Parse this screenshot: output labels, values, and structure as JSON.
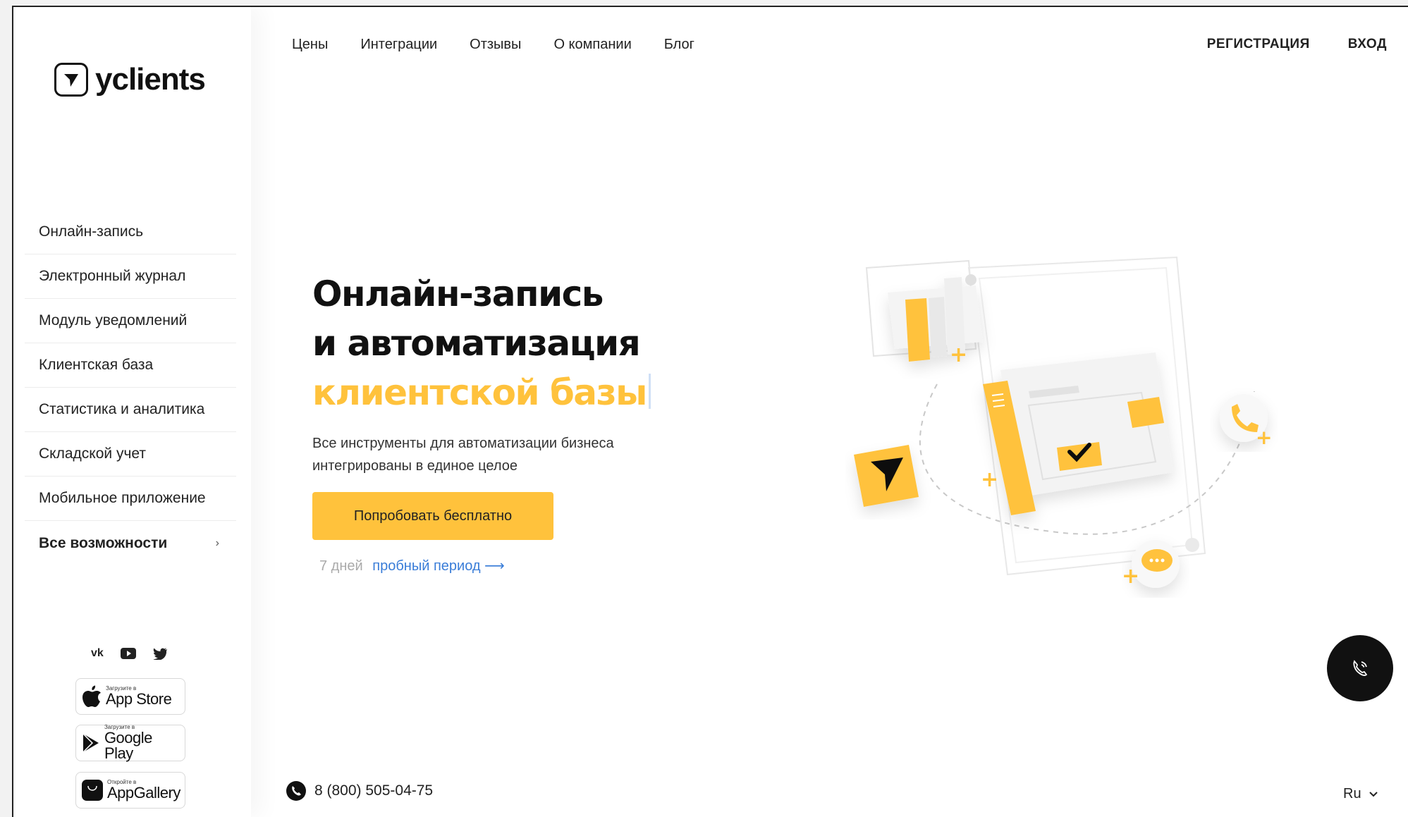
{
  "logo": {
    "text": "yclients"
  },
  "nav": {
    "links": [
      "Цены",
      "Интеграции",
      "Отзывы",
      "О компании",
      "Блог"
    ],
    "register": "РЕГИСТРАЦИЯ",
    "login": "ВХОД"
  },
  "sidebar": {
    "items": [
      "Онлайн-запись",
      "Электронный журнал",
      "Модуль уведомлений",
      "Клиентская база",
      "Статистика и аналитика",
      "Складской учет",
      "Мобильное приложение"
    ],
    "all_features": "Все возможности",
    "social_icons": [
      "vk-icon",
      "youtube-icon",
      "twitter-icon"
    ],
    "stores": [
      {
        "small": "Загрузите в",
        "big": "App Store",
        "icon": "apple-icon"
      },
      {
        "small": "Загрузите в",
        "big": "Google Play",
        "icon": "google-play-icon"
      },
      {
        "small": "Откройте в",
        "big": "AppGallery",
        "icon": "huawei-icon"
      }
    ]
  },
  "hero": {
    "title_line1": "Онлайн-запись",
    "title_line2": "и автоматизация",
    "title_accent": "клиентской базы",
    "subtitle_line1": "Все инструменты для автоматизации бизнеса",
    "subtitle_line2": "интегрированы в единое целое",
    "cta": "Попробовать бесплатно",
    "trial_days": "7 дней",
    "trial_link": "пробный период ⟶"
  },
  "footer": {
    "phone": "8 (800) 505-04-75",
    "lang": "Ru"
  },
  "colors": {
    "accent": "#ffc23c",
    "link": "#3a7dd8",
    "dark": "#111111"
  }
}
